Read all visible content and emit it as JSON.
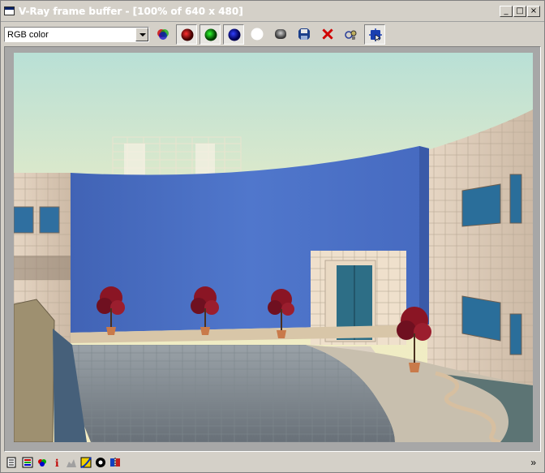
{
  "window": {
    "title": "V-Ray frame buffer - [100% of 640 x 480]",
    "controls": {
      "minimize": "_",
      "maximize": "□",
      "close": "×"
    }
  },
  "toolbar": {
    "channel_select": {
      "value": "RGB color"
    },
    "buttons": [
      {
        "name": "display-color-channels",
        "icon": "rgb-channels-icon"
      },
      {
        "name": "show-red-channel",
        "icon": "red-channel-icon",
        "color": "#b00000"
      },
      {
        "name": "show-green-channel",
        "icon": "green-channel-icon",
        "color": "#00a000"
      },
      {
        "name": "show-blue-channel",
        "icon": "blue-channel-icon",
        "color": "#000080"
      },
      {
        "name": "switch-to-alpha",
        "icon": "alpha-channel-icon"
      },
      {
        "name": "monochrome-mode",
        "icon": "monochrome-icon"
      },
      {
        "name": "save-image",
        "icon": "save-icon"
      },
      {
        "name": "clear-image",
        "icon": "clear-icon"
      },
      {
        "name": "duplicate-to-max-frame-buffer",
        "icon": "duplicate-icon"
      },
      {
        "name": "track-mouse-region",
        "icon": "region-render-icon"
      }
    ]
  },
  "render": {
    "description": "Rendered architectural scene: curved blue wall with courtyard and planters",
    "zoom": "100%",
    "resolution": "640 x 480"
  },
  "statusbar": {
    "icons": [
      "history-icon",
      "color-correction-icon",
      "info-icon",
      "levels-icon",
      "curve-icon",
      "lens-effects-icon",
      "compare-icon"
    ],
    "expand": "»"
  },
  "colors": {
    "window_bg": "#d4d0c8",
    "wall_blue": "#4e6fc2",
    "sky_top": "#b9e0d6",
    "sky_horizon": "#f5edc2"
  }
}
